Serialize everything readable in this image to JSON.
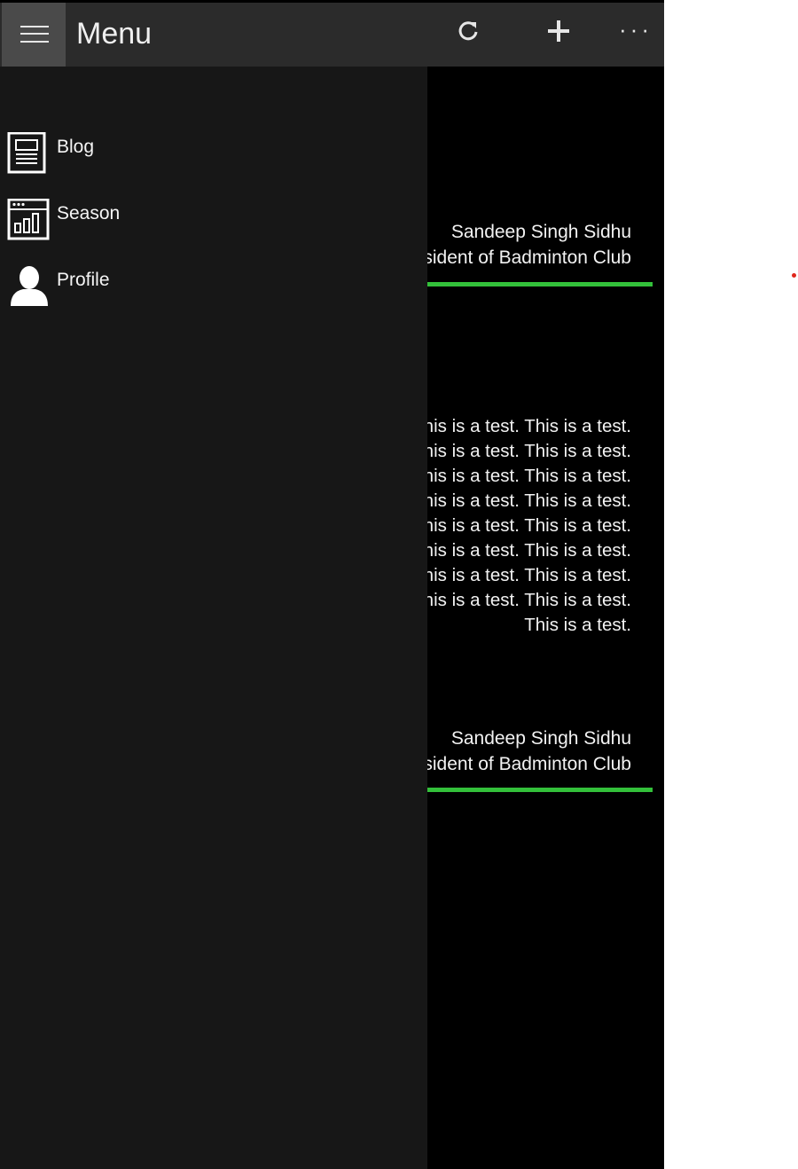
{
  "header": {
    "title": "Menu",
    "buttons": {
      "menu": "hamburger-icon",
      "refresh": "refresh-icon",
      "add": "plus-icon",
      "more": "more-icon"
    },
    "more_label": "···"
  },
  "nav": {
    "items": [
      {
        "label": "Blog",
        "icon": "newspaper-icon"
      },
      {
        "label": "Season",
        "icon": "chart-icon"
      },
      {
        "label": "Profile",
        "icon": "user-icon"
      }
    ]
  },
  "posts": [
    {
      "author_name": "Sandeep Singh Sidhu",
      "author_role": "President of Badminton Club"
    },
    {
      "text": "This is a test. This is a test. This is a test. This is a test. This is a test. This is a test. This is a test. This is a test. This is a test. This is a test. This is a test. This is a test. This is a test. This is a test. This is a test. This is a test. This is a test. This is a test. This is a test. This is a test. This is a test. This is a test. This is a test. This is a test. This is a test. This is a test. This is a test. This is a test. This is a test. This is a test. This is a test. This is a test. This is a test.",
      "author_name": "Sandeep Singh Sidhu",
      "author_role": "President of Badminton Club"
    }
  ],
  "colors": {
    "accent": "#33c03a",
    "drawer": "#171717",
    "titlebar": "#2b2b2b"
  }
}
